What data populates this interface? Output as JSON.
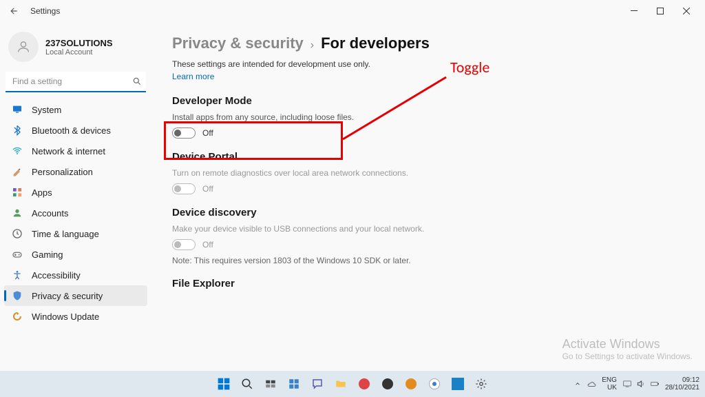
{
  "app_title": "Settings",
  "account": {
    "name": "237SOLUTIONS",
    "type": "Local Account"
  },
  "search": {
    "placeholder": "Find a setting"
  },
  "nav": {
    "items": [
      {
        "label": "System"
      },
      {
        "label": "Bluetooth & devices"
      },
      {
        "label": "Network & internet"
      },
      {
        "label": "Personalization"
      },
      {
        "label": "Apps"
      },
      {
        "label": "Accounts"
      },
      {
        "label": "Time & language"
      },
      {
        "label": "Gaming"
      },
      {
        "label": "Accessibility"
      },
      {
        "label": "Privacy & security"
      },
      {
        "label": "Windows Update"
      }
    ]
  },
  "breadcrumb": {
    "parent": "Privacy & security",
    "current": "For developers"
  },
  "intro": {
    "line": "These settings are intended for development use only.",
    "link": "Learn more"
  },
  "sections": {
    "dev_mode": {
      "title": "Developer Mode",
      "desc": "Install apps from any source, including loose files.",
      "toggle": "Off"
    },
    "device_portal": {
      "title": "Device Portal",
      "desc": "Turn on remote diagnostics over local area network connections.",
      "toggle": "Off"
    },
    "device_discovery": {
      "title": "Device discovery",
      "desc": "Make your device visible to USB connections and your local network.",
      "toggle": "Off",
      "note": "Note: This requires version 1803 of the Windows 10 SDK or later."
    },
    "file_explorer": {
      "title": "File Explorer"
    }
  },
  "annotation": {
    "text": "Toggle"
  },
  "watermark": {
    "title": "Activate Windows",
    "sub": "Go to Settings to activate Windows."
  },
  "taskbar": {
    "lang1": "ENG",
    "lang2": "UK",
    "time": "09:12",
    "date": "28/10/2021"
  }
}
